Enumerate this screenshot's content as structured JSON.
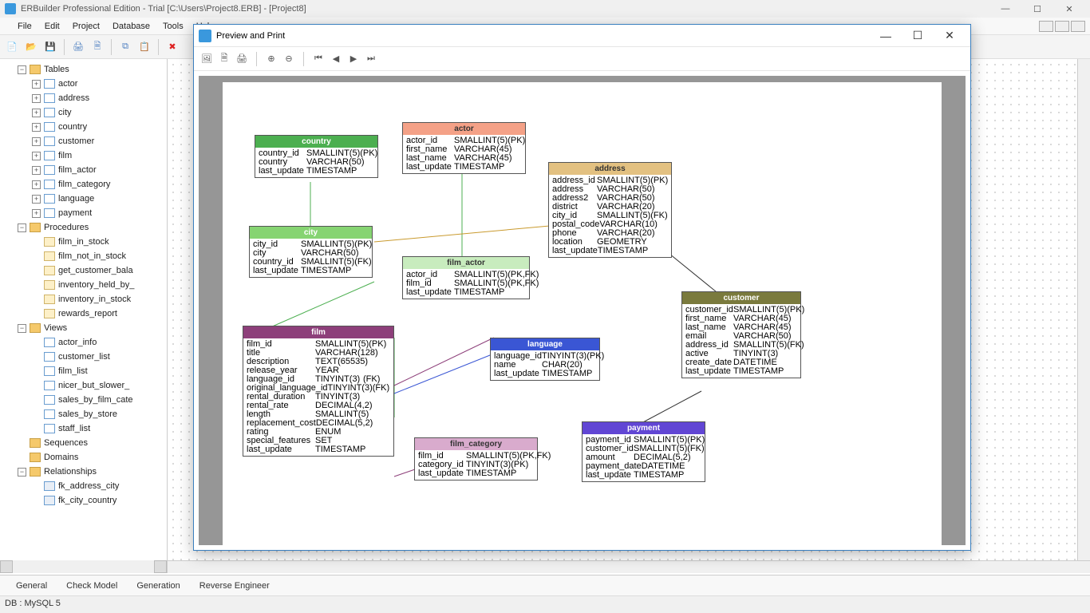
{
  "app": {
    "title": "ERBuilder Professional Edition  - Trial [C:\\Users\\Project8.ERB] - [Project8]",
    "preview_title": "Preview and Print"
  },
  "menu": {
    "file": "File",
    "edit": "Edit",
    "project": "Project",
    "database": "Database",
    "tools": "Tools",
    "help": "Help"
  },
  "tree": {
    "tables": "Tables",
    "procedures": "Procedures",
    "views": "Views",
    "sequences": "Sequences",
    "domains": "Domains",
    "relationships": "Relationships",
    "tbl": {
      "actor": "actor",
      "address": "address",
      "city": "city",
      "country": "country",
      "customer": "customer",
      "film": "film",
      "film_actor": "film_actor",
      "film_category": "film_category",
      "language": "language",
      "payment": "payment"
    },
    "proc": {
      "p1": "film_in_stock",
      "p2": "film_not_in_stock",
      "p3": "get_customer_bala",
      "p4": "inventory_held_by_",
      "p5": "inventory_in_stock",
      "p6": "rewards_report"
    },
    "view": {
      "v1": "actor_info",
      "v2": "customer_list",
      "v3": "film_list",
      "v4": "nicer_but_slower_",
      "v5": "sales_by_film_cate",
      "v6": "sales_by_store",
      "v7": "staff_list"
    },
    "rel": {
      "r1": "fk_address_city",
      "r2": "fk_city_country"
    }
  },
  "tabs": {
    "general": "General",
    "check": "Check Model",
    "gen": "Generation",
    "rev": "Reverse Engineer"
  },
  "status": "DB : MySQL 5",
  "erd": {
    "country": {
      "name": "country",
      "r1c1": "country_id",
      "r1c2": "SMALLINT(5)",
      "r1c3": "(PK)",
      "r2c1": "country",
      "r2c2": "VARCHAR(50)",
      "r3c1": "last_update",
      "r3c2": "TIMESTAMP"
    },
    "city": {
      "name": "city",
      "r1c1": "city_id",
      "r1c2": "SMALLINT(5)",
      "r1c3": "(PK)",
      "r2c1": "city",
      "r2c2": "VARCHAR(50)",
      "r3c1": "country_id",
      "r3c2": "SMALLINT(5)",
      "r3c3": "(FK)",
      "r4c1": "last_update",
      "r4c2": "TIMESTAMP"
    },
    "actor": {
      "name": "actor",
      "r1c1": "actor_id",
      "r1c2": "SMALLINT(5)",
      "r1c3": "(PK)",
      "r2c1": "first_name",
      "r2c2": "VARCHAR(45)",
      "r3c1": "last_name",
      "r3c2": "VARCHAR(45)",
      "r4c1": "last_update",
      "r4c2": "TIMESTAMP"
    },
    "film_actor": {
      "name": "film_actor",
      "r1c1": "actor_id",
      "r1c2": "SMALLINT(5)",
      "r1c3": "(PK,FK)",
      "r2c1": "film_id",
      "r2c2": "SMALLINT(5)",
      "r2c3": "(PK,FK)",
      "r3c1": "last_update",
      "r3c2": "TIMESTAMP"
    },
    "address": {
      "name": "address",
      "r1c1": "address_id",
      "r1c2": "SMALLINT(5)",
      "r1c3": "(PK)",
      "r2c1": "address",
      "r2c2": "VARCHAR(50)",
      "r3c1": "address2",
      "r3c2": "VARCHAR(50)",
      "r4c1": "district",
      "r4c2": "VARCHAR(20)",
      "r5c1": "city_id",
      "r5c2": "SMALLINT(5)",
      "r5c3": "(FK)",
      "r6c1": "postal_code",
      "r6c2": "VARCHAR(10)",
      "r7c1": "phone",
      "r7c2": "VARCHAR(20)",
      "r8c1": "location",
      "r8c2": "GEOMETRY",
      "r9c1": "last_update",
      "r9c2": "TIMESTAMP"
    },
    "customer": {
      "name": "customer",
      "r1c1": "customer_id",
      "r1c2": "SMALLINT(5)",
      "r1c3": "(PK)",
      "r2c1": "first_name",
      "r2c2": "VARCHAR(45)",
      "r3c1": "last_name",
      "r3c2": "VARCHAR(45)",
      "r4c1": "email",
      "r4c2": "VARCHAR(50)",
      "r5c1": "address_id",
      "r5c2": "SMALLINT(5)",
      "r5c3": "(FK)",
      "r6c1": "active",
      "r6c2": "TINYINT(3)",
      "r7c1": "create_date",
      "r7c2": "DATETIME",
      "r8c1": "last_update",
      "r8c2": "TIMESTAMP"
    },
    "film": {
      "name": "film",
      "r1c1": "film_id",
      "r1c2": "SMALLINT(5)",
      "r1c3": "(PK)",
      "r2c1": "title",
      "r2c2": "VARCHAR(128)",
      "r3c1": "description",
      "r3c2": "TEXT(65535)",
      "r4c1": "release_year",
      "r4c2": "YEAR",
      "r5c1": "language_id",
      "r5c2": "TINYINT(3)",
      "r5c3": "(FK)",
      "r6c1": "original_language_id",
      "r6c2": "TINYINT(3)",
      "r6c3": "(FK)",
      "r7c1": "rental_duration",
      "r7c2": "TINYINT(3)",
      "r8c1": "rental_rate",
      "r8c2": "DECIMAL(4,2)",
      "r9c1": "length",
      "r9c2": "SMALLINT(5)",
      "r10c1": "replacement_cost",
      "r10c2": "DECIMAL(5,2)",
      "r11c1": "rating",
      "r11c2": "ENUM",
      "r12c1": "special_features",
      "r12c2": "SET",
      "r13c1": "last_update",
      "r13c2": "TIMESTAMP"
    },
    "language": {
      "name": "language",
      "r1c1": "language_id",
      "r1c2": "TINYINT(3)",
      "r1c3": "(PK)",
      "r2c1": "name",
      "r2c2": "CHAR(20)",
      "r3c1": "last_update",
      "r3c2": "TIMESTAMP"
    },
    "film_category": {
      "name": "film_category",
      "r1c1": "film_id",
      "r1c2": "SMALLINT(5)",
      "r1c3": "(PK,FK)",
      "r2c1": "category_id",
      "r2c2": "TINYINT(3)",
      "r2c3": "(PK)",
      "r3c1": "last_update",
      "r3c2": "TIMESTAMP"
    },
    "payment": {
      "name": "payment",
      "r1c1": "payment_id",
      "r1c2": "SMALLINT(5)",
      "r1c3": "(PK)",
      "r2c1": "customer_id",
      "r2c2": "SMALLINT(5)",
      "r2c3": "(FK)",
      "r3c1": "amount",
      "r3c2": "DECIMAL(5,2)",
      "r4c1": "payment_date",
      "r4c2": "DATETIME",
      "r5c1": "last_update",
      "r5c2": "TIMESTAMP"
    }
  }
}
